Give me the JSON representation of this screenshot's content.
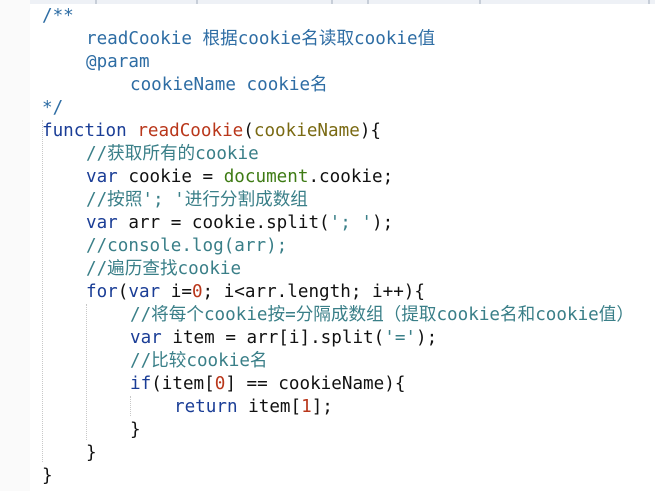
{
  "editor": {
    "lines": [
      {
        "indent": 0,
        "tokens": [
          {
            "t": "/**",
            "c": "cm"
          }
        ]
      },
      {
        "indent": 1,
        "tokens": [
          {
            "t": "readCookie 根据cookie名读取cookie值",
            "c": "cm"
          }
        ]
      },
      {
        "indent": 1,
        "tokens": [
          {
            "t": "@param",
            "c": "cm"
          }
        ]
      },
      {
        "indent": 2,
        "tokens": [
          {
            "t": "cookieName cookie名",
            "c": "cm"
          }
        ]
      },
      {
        "indent": 0,
        "tokens": [
          {
            "t": "*/",
            "c": "cm"
          }
        ]
      },
      {
        "indent": 0,
        "tokens": [
          {
            "t": "function",
            "c": "kw"
          },
          {
            "t": " ",
            "c": "tx"
          },
          {
            "t": "readCookie",
            "c": "fn"
          },
          {
            "t": "(",
            "c": "tx"
          },
          {
            "t": "cookieName",
            "c": "pm"
          },
          {
            "t": "){",
            "c": "tx"
          }
        ]
      },
      {
        "indent": 1,
        "tokens": [
          {
            "t": "//获取所有的cookie",
            "c": "cmc"
          }
        ]
      },
      {
        "indent": 1,
        "tokens": [
          {
            "t": "var",
            "c": "kw"
          },
          {
            "t": " cookie = ",
            "c": "tx"
          },
          {
            "t": "document",
            "c": "bi"
          },
          {
            "t": ".cookie;",
            "c": "tx"
          }
        ]
      },
      {
        "indent": 1,
        "tokens": [
          {
            "t": "//按照'; '进行分割成数组",
            "c": "cmc"
          }
        ]
      },
      {
        "indent": 1,
        "tokens": [
          {
            "t": "var",
            "c": "kw"
          },
          {
            "t": " arr = cookie.split(",
            "c": "tx"
          },
          {
            "t": "'; '",
            "c": "st"
          },
          {
            "t": ");",
            "c": "tx"
          }
        ]
      },
      {
        "indent": 1,
        "tokens": [
          {
            "t": "//console.log(arr);",
            "c": "cmc"
          }
        ]
      },
      {
        "indent": 1,
        "tokens": [
          {
            "t": "//遍历查找cookie",
            "c": "cmc"
          }
        ]
      },
      {
        "indent": 1,
        "tokens": [
          {
            "t": "for",
            "c": "kw"
          },
          {
            "t": "(",
            "c": "tx"
          },
          {
            "t": "var",
            "c": "kw"
          },
          {
            "t": " i=",
            "c": "tx"
          },
          {
            "t": "0",
            "c": "nu"
          },
          {
            "t": "; i<arr.length; i++){",
            "c": "tx"
          }
        ]
      },
      {
        "indent": 2,
        "tokens": [
          {
            "t": "//将每个cookie按=分隔成数组（提取cookie名和cookie值）",
            "c": "cmc"
          }
        ]
      },
      {
        "indent": 2,
        "tokens": [
          {
            "t": "var",
            "c": "kw"
          },
          {
            "t": " item = arr[i].split(",
            "c": "tx"
          },
          {
            "t": "'='",
            "c": "st"
          },
          {
            "t": ");",
            "c": "tx"
          }
        ]
      },
      {
        "indent": 2,
        "tokens": [
          {
            "t": "//比较cookie名",
            "c": "cmc"
          }
        ]
      },
      {
        "indent": 2,
        "tokens": [
          {
            "t": "if",
            "c": "kw"
          },
          {
            "t": "(item[",
            "c": "tx"
          },
          {
            "t": "0",
            "c": "nu"
          },
          {
            "t": "] == cookieName){",
            "c": "tx"
          }
        ]
      },
      {
        "indent": 3,
        "tokens": [
          {
            "t": "return",
            "c": "kw"
          },
          {
            "t": " item[",
            "c": "tx"
          },
          {
            "t": "1",
            "c": "nu"
          },
          {
            "t": "];",
            "c": "tx"
          }
        ]
      },
      {
        "indent": 2,
        "tokens": [
          {
            "t": "}",
            "c": "tx"
          }
        ]
      },
      {
        "indent": 1,
        "tokens": [
          {
            "t": "}",
            "c": "tx"
          }
        ]
      },
      {
        "indent": 0,
        "tokens": [
          {
            "t": "}",
            "c": "tx"
          }
        ]
      }
    ]
  }
}
